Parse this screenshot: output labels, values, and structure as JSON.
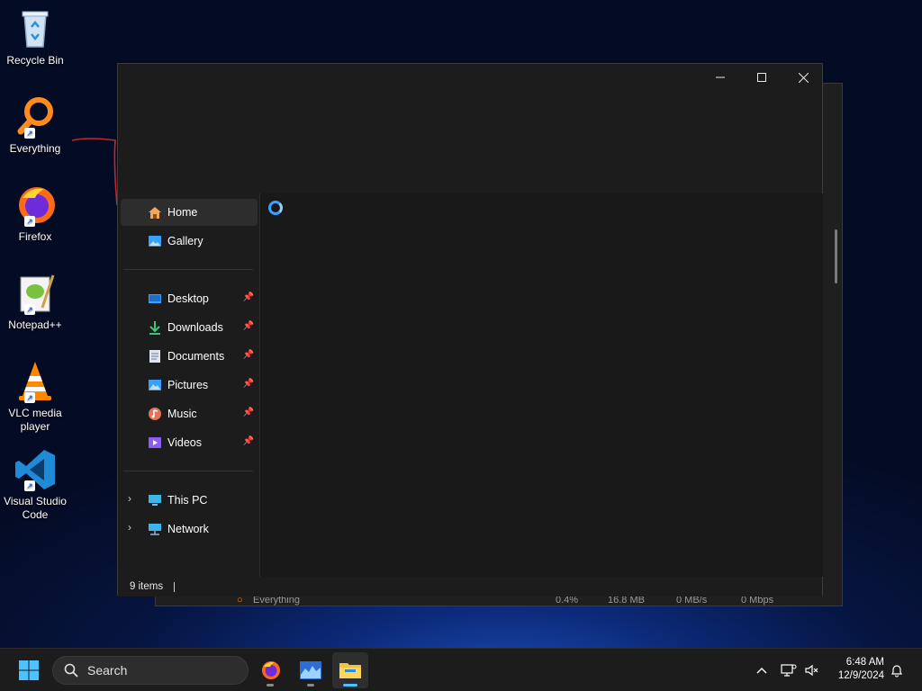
{
  "desktop": {
    "icons": [
      {
        "label": "Recycle Bin"
      },
      {
        "label": "Everything"
      },
      {
        "label": "Firefox"
      },
      {
        "label": "Notepad++"
      },
      {
        "label": "VLC media player"
      },
      {
        "label": "Visual Studio Code"
      }
    ]
  },
  "background_window": {
    "row": {
      "name": "Everything",
      "cpu": "0.4%",
      "memory": "16.8 MB",
      "disk": "0 MB/s",
      "network": "0 Mbps"
    }
  },
  "explorer": {
    "nav": {
      "home": "Home",
      "gallery": "Gallery",
      "pinned": [
        {
          "label": "Desktop"
        },
        {
          "label": "Downloads"
        },
        {
          "label": "Documents"
        },
        {
          "label": "Pictures"
        },
        {
          "label": "Music"
        },
        {
          "label": "Videos"
        }
      ],
      "this_pc": "This PC",
      "network": "Network"
    },
    "status": {
      "items": "9 items"
    }
  },
  "taskbar": {
    "search_placeholder": "Search",
    "time": "6:48 AM",
    "date": "12/9/2024"
  },
  "colors": {
    "accent": "#4cc2ff",
    "window_bg": "#191919",
    "selected_nav": "#2d2d2d"
  }
}
